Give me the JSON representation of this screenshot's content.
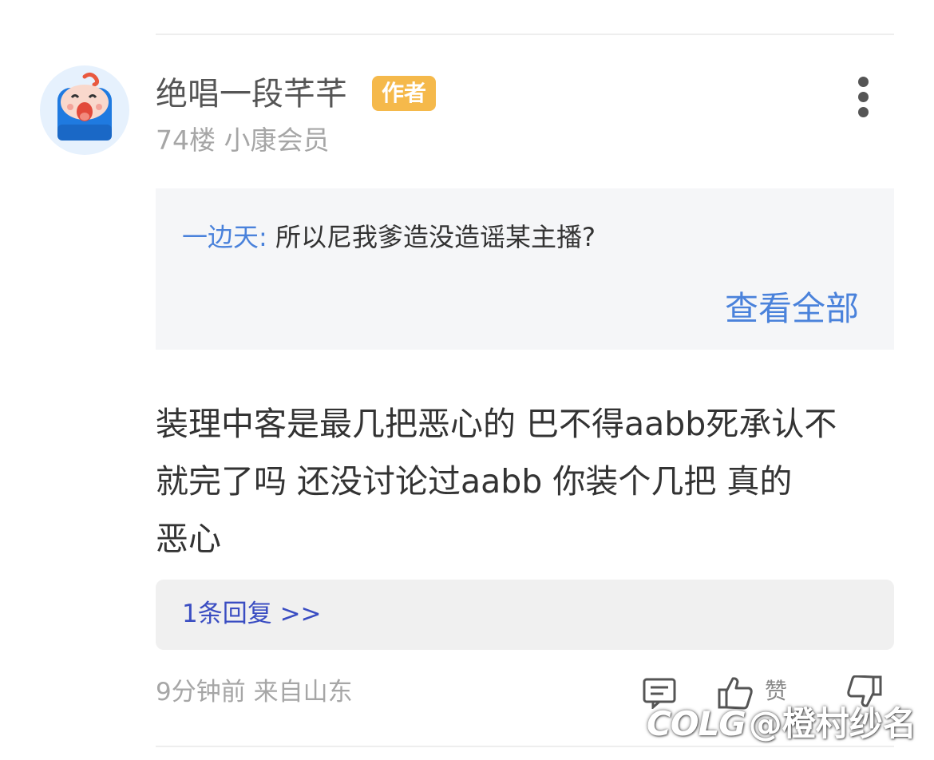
{
  "comment": {
    "author": "绝唱一段芊芊",
    "badge": "作者",
    "floor_and_level": "74楼 小康会员",
    "quote": {
      "author_label": "一边天:",
      "text": "所以尼我爹造没造谣某主播?",
      "view_all_label": "查看全部"
    },
    "body_lines": [
      "装理中客是最几把恶心的 巴不得aabb死承认不",
      "就完了吗  还没讨论过aabb  你装个几把 真的",
      "恶心"
    ],
    "replies_label": "1条回复 >>",
    "time_location": "9分钟前 来自山东",
    "like_label": "赞"
  },
  "icons": {
    "avatar": "cartoon-avatar-icon",
    "more": "more-vertical-icon",
    "reply": "comment-icon",
    "like": "thumbs-up-icon",
    "dislike": "thumbs-down-icon"
  },
  "colors": {
    "badge": "#f5b94b",
    "link_blue": "#4a82db",
    "reply_blue": "#3a4dc2",
    "avatar_bg": "#e6f1fd",
    "quote_bg": "#f5f6f8"
  },
  "watermark": {
    "logo": "COLG",
    "handle": "@橙村纱名"
  }
}
